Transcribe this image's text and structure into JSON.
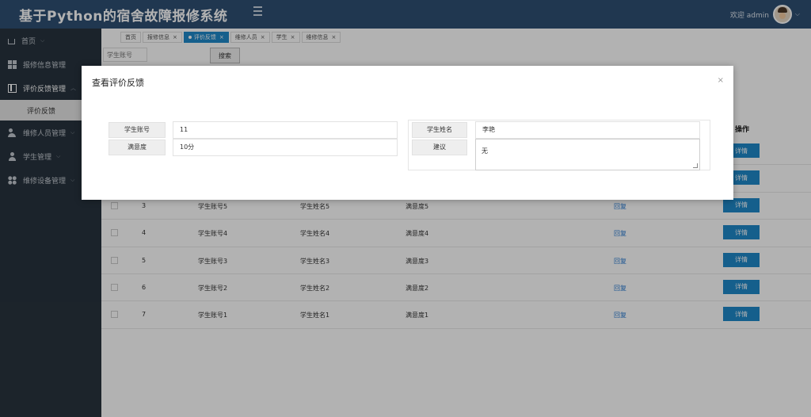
{
  "header": {
    "app_title": "基于Python的宿舍故障报修系统",
    "welcome_text": "欢迎 admin"
  },
  "sidebar": {
    "items": [
      {
        "label": "首页"
      },
      {
        "label": "报修信息管理"
      },
      {
        "label": "评价反馈管理"
      },
      {
        "label": "维修人员管理"
      },
      {
        "label": "学生管理"
      },
      {
        "label": "维修设备管理"
      }
    ],
    "active_sub": "评价反馈"
  },
  "tabs": [
    {
      "label": "首页"
    },
    {
      "label": "报修信息"
    },
    {
      "label": "评价反馈"
    },
    {
      "label": "维修人员"
    },
    {
      "label": "学生"
    },
    {
      "label": "维修信息"
    }
  ],
  "search": {
    "placeholder": "学生账号",
    "button_label": "搜索"
  },
  "table": {
    "ops_header": "操作",
    "rows": [
      {
        "idx": "3",
        "account": "学生账号5",
        "name": "学生姓名5",
        "satisfaction": "满意度5",
        "reply": "回复",
        "action": "详情"
      },
      {
        "idx": "4",
        "account": "学生账号4",
        "name": "学生姓名4",
        "satisfaction": "满意度4",
        "reply": "回复",
        "action": "详情"
      },
      {
        "idx": "5",
        "account": "学生账号3",
        "name": "学生姓名3",
        "satisfaction": "满意度3",
        "reply": "回复",
        "action": "详情"
      },
      {
        "idx": "6",
        "account": "学生账号2",
        "name": "学生姓名2",
        "satisfaction": "满意度2",
        "reply": "回复",
        "action": "详情"
      },
      {
        "idx": "7",
        "account": "学生账号1",
        "name": "学生姓名1",
        "satisfaction": "满意度1",
        "reply": "回复",
        "action": "详情"
      }
    ],
    "hidden_action_1": "详情",
    "hidden_action_2": "详情"
  },
  "modal": {
    "title": "查看评价反馈",
    "close_glyph": "×",
    "fields": {
      "student_account_label": "学生账号",
      "student_account_value": "11",
      "student_name_label": "学生姓名",
      "student_name_value": "李艳",
      "satisfaction_label": "满意度",
      "satisfaction_value": "10分",
      "suggestion_label": "建议",
      "suggestion_value": "无"
    }
  }
}
